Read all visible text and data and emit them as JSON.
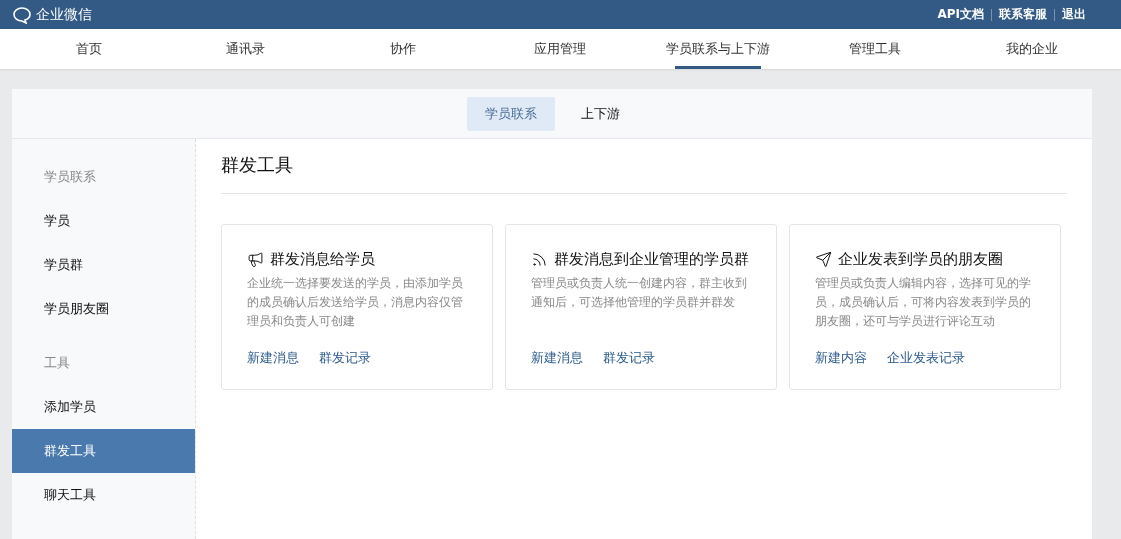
{
  "top_bar": {
    "logo": "企业微信",
    "links": [
      "API文档",
      "联系客服",
      "退出"
    ]
  },
  "nav": [
    {
      "label": "首页",
      "selected": false
    },
    {
      "label": "通讯录",
      "selected": false
    },
    {
      "label": "协作",
      "selected": false
    },
    {
      "label": "应用管理",
      "selected": false
    },
    {
      "label": "学员联系与上下游",
      "selected": true
    },
    {
      "label": "管理工具",
      "selected": false
    },
    {
      "label": "我的企业",
      "selected": false
    }
  ],
  "sub_tabs": [
    {
      "label": "学员联系",
      "selected": true
    },
    {
      "label": "上下游",
      "selected": false
    }
  ],
  "sidebar": [
    {
      "kind": "header",
      "label": "学员联系"
    },
    {
      "kind": "item",
      "label": "学员",
      "selected": false
    },
    {
      "kind": "item",
      "label": "学员群",
      "selected": false
    },
    {
      "kind": "item",
      "label": "学员朋友圈",
      "selected": false
    },
    {
      "kind": "header",
      "label": "工具"
    },
    {
      "kind": "item",
      "label": "添加学员",
      "selected": false
    },
    {
      "kind": "item",
      "label": "群发工具",
      "selected": true
    },
    {
      "kind": "item",
      "label": "聊天工具",
      "selected": false
    }
  ],
  "page_title": "群发工具",
  "cards": [
    {
      "title": "群发消息给学员",
      "description": "企业统一选择要发送的学员，由添加学员的成员确认后发送给学员，消息内容仅管理员和负责人可创建",
      "actions": [
        "新建消息",
        "群发记录"
      ]
    },
    {
      "title": "群发消息到企业管理的学员群",
      "description": "管理员或负责人统一创建内容，群主收到通知后，可选择他管理的学员群并群发",
      "actions": [
        "新建消息",
        "群发记录"
      ]
    },
    {
      "title": "企业发表到学员的朋友圈",
      "description": "管理员或负责人编辑内容，选择可见的学员，成员确认后，可将内容发表到学员的朋友圈，还可与学员进行评论互动",
      "actions": [
        "新建内容",
        "企业发表记录"
      ]
    }
  ]
}
